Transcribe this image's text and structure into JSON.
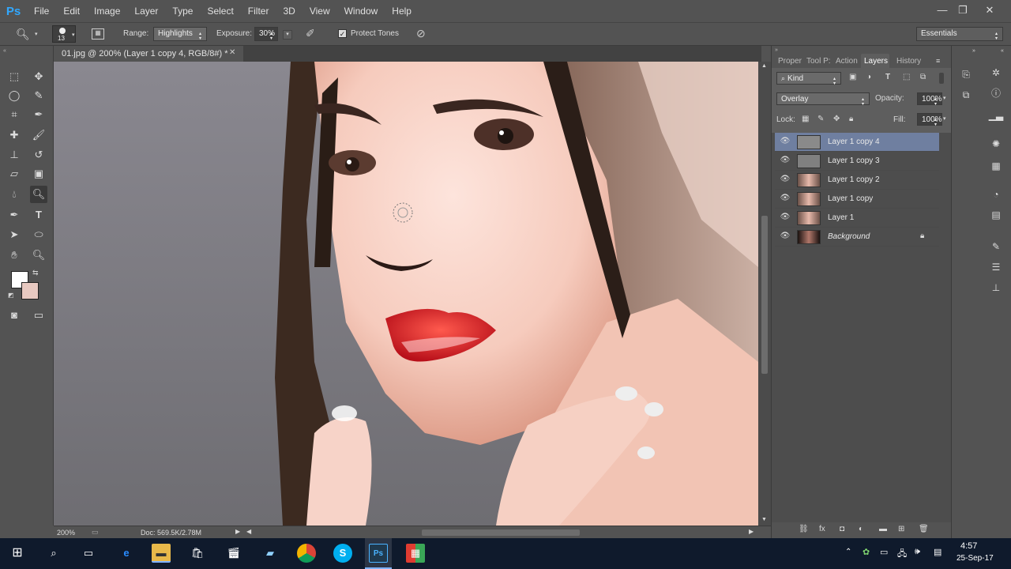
{
  "app": {
    "logo": "Ps",
    "menu": [
      "File",
      "Edit",
      "Image",
      "Layer",
      "Type",
      "Select",
      "Filter",
      "3D",
      "View",
      "Window",
      "Help"
    ],
    "workspace": "Essentials"
  },
  "options": {
    "brush_size": "13",
    "range_label": "Range:",
    "range_value": "Highlights",
    "exposure_label": "Exposure:",
    "exposure_value": "30%",
    "protect_tones_label": "Protect Tones"
  },
  "document": {
    "tab_title": "01.jpg @ 200% (Layer 1 copy 4, RGB/8#) *",
    "zoom": "200%",
    "doc_size": "Doc: 569.5K/2.78M"
  },
  "panels": {
    "tabs": [
      "Proper",
      "Tool P:",
      "Action",
      "Layers",
      "History"
    ],
    "active_tab": "Layers",
    "filter_kind": "Kind",
    "blend_mode": "Overlay",
    "opacity_label": "Opacity:",
    "opacity_value": "100%",
    "lock_label": "Lock:",
    "fill_label": "Fill:",
    "fill_value": "100%",
    "layers": [
      {
        "name": "Layer 1 copy 4",
        "selected": true,
        "thumb": "gray"
      },
      {
        "name": "Layer 1 copy 3",
        "selected": false,
        "thumb": "gray"
      },
      {
        "name": "Layer 1 copy 2",
        "selected": false,
        "thumb": "face"
      },
      {
        "name": "Layer 1 copy",
        "selected": false,
        "thumb": "face"
      },
      {
        "name": "Layer 1",
        "selected": false,
        "thumb": "face"
      },
      {
        "name": "Background",
        "selected": false,
        "thumb": "dark",
        "locked": true
      }
    ]
  },
  "taskbar": {
    "time": "4:57",
    "date": "25-Sep-17"
  },
  "colors": {
    "accent": "#31a8ff",
    "selected_layer": "#6f7fa0",
    "panel_bg": "#535353"
  }
}
